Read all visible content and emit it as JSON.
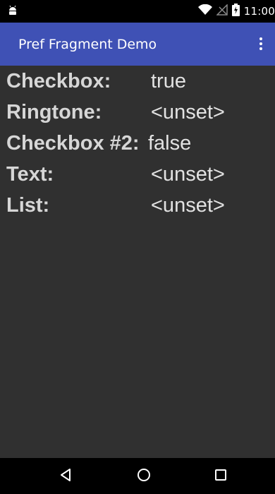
{
  "status_bar": {
    "time": "11:00",
    "icons": [
      "android-debug-icon",
      "wifi-icon",
      "no-signal-icon",
      "battery-charging-icon"
    ]
  },
  "app_bar": {
    "title": "Pref Fragment Demo",
    "overflow_icon": "more-vert-icon"
  },
  "preferences": [
    {
      "label": "Checkbox:",
      "value": "true"
    },
    {
      "label": "Ringtone:",
      "value": "<unset>"
    },
    {
      "label": "Checkbox #2:",
      "value": "false"
    },
    {
      "label": "Text:",
      "value": "<unset>"
    },
    {
      "label": "List:",
      "value": "<unset>"
    }
  ],
  "nav_bar": {
    "buttons": [
      "back-icon",
      "home-icon",
      "recents-icon"
    ]
  },
  "colors": {
    "app_bar": "#3f51b5",
    "background": "#303030",
    "status_bar": "#000000",
    "nav_bar": "#000000"
  }
}
